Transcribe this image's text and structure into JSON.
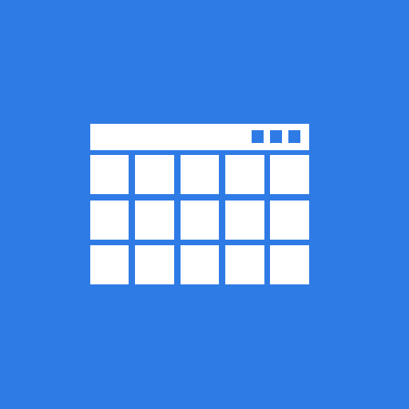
{
  "app_icon": {
    "name": "window-grid-icon",
    "rows": 3,
    "columns": 5,
    "title_bar_buttons": 3
  },
  "colors": {
    "background": "#2f7be6",
    "foreground": "#ffffff"
  }
}
